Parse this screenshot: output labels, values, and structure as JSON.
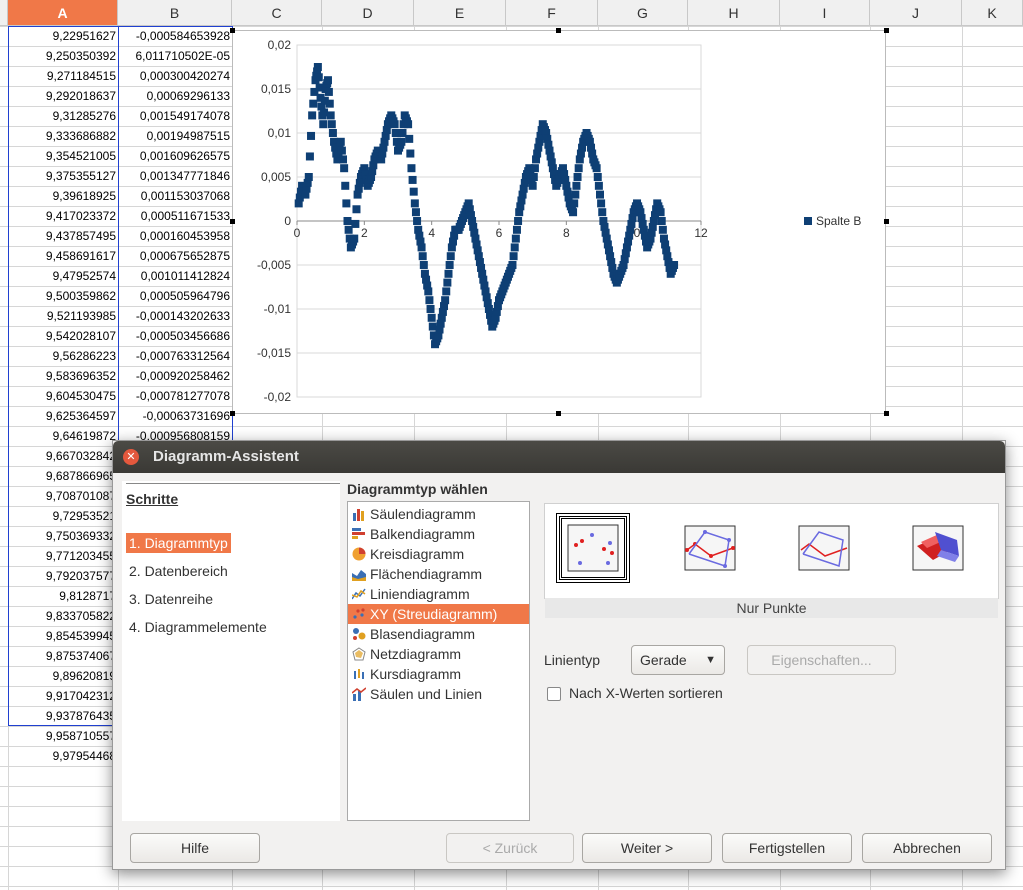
{
  "spreadsheet": {
    "columns": [
      "A",
      "B",
      "C",
      "D",
      "E",
      "F",
      "G",
      "H",
      "I",
      "J",
      "K"
    ],
    "selected_column": "A",
    "col_a": [
      "9,22951627",
      "9,250350392",
      "9,271184515",
      "9,292018637",
      "9,31285276",
      "9,333686882",
      "9,354521005",
      "9,375355127",
      "9,39618925",
      "9,417023372",
      "9,437857495",
      "9,458691617",
      "9,47952574",
      "9,500359862",
      "9,521193985",
      "9,542028107",
      "9,56286223",
      "9,583696352",
      "9,604530475",
      "9,625364597",
      "9,64619872",
      "9,667032842",
      "9,687866965",
      "9,708701087",
      "9,72953521",
      "9,750369332",
      "9,771203455",
      "9,792037577",
      "9,8128717",
      "9,833705822",
      "9,854539945",
      "9,875374067",
      "9,89620819",
      "9,917042312",
      "9,937876435",
      "9,958710557",
      "9,97954468"
    ],
    "col_b": [
      "-0,000584653928",
      "6,011710502E-05",
      "0,000300420274",
      "0,00069296133",
      "0,001549174078",
      "0,00194987515",
      "0,001609626575",
      "0,001347771846",
      "0,001153037068",
      "0,000511671533",
      "0,000160453958",
      "0,000675652875",
      "0,001011412824",
      "0,000505964796",
      "-0,000143202633",
      "-0,000503456686",
      "-0,000763312564",
      "-0,000920258462",
      "-0,000781277078",
      "-0,00063731696",
      "-0,000956808159",
      "-0,00148660806"
    ]
  },
  "chart": {
    "legend_label": "Spalte B",
    "series_color": "#0e3f74"
  },
  "chart_data": {
    "type": "scatter",
    "series": [
      {
        "name": "Spalte B",
        "points": [
          [
            0.05,
            0.002
          ],
          [
            0.15,
            0.004
          ],
          [
            0.25,
            0.003
          ],
          [
            0.35,
            0.005
          ],
          [
            0.45,
            0.012
          ],
          [
            0.55,
            0.016
          ],
          [
            0.62,
            0.0175
          ],
          [
            0.7,
            0.014
          ],
          [
            0.78,
            0.011
          ],
          [
            0.85,
            0.015
          ],
          [
            0.92,
            0.016
          ],
          [
            1.0,
            0.012
          ],
          [
            1.1,
            0.009
          ],
          [
            1.2,
            0.007
          ],
          [
            1.3,
            0.009
          ],
          [
            1.4,
            0.006
          ],
          [
            1.5,
            0.0
          ],
          [
            1.6,
            -0.003
          ],
          [
            1.7,
            -0.002
          ],
          [
            1.8,
            0.003
          ],
          [
            1.9,
            0.005
          ],
          [
            2.0,
            0.006
          ],
          [
            2.1,
            0.004
          ],
          [
            2.2,
            0.005
          ],
          [
            2.3,
            0.007
          ],
          [
            2.4,
            0.008
          ],
          [
            2.5,
            0.007
          ],
          [
            2.6,
            0.009
          ],
          [
            2.7,
            0.011
          ],
          [
            2.8,
            0.012
          ],
          [
            2.9,
            0.011
          ],
          [
            3.0,
            0.008
          ],
          [
            3.1,
            0.009
          ],
          [
            3.2,
            0.012
          ],
          [
            3.3,
            0.011
          ],
          [
            3.4,
            0.006
          ],
          [
            3.5,
            0.002
          ],
          [
            3.6,
            -0.001
          ],
          [
            3.7,
            -0.003
          ],
          [
            3.8,
            -0.006
          ],
          [
            3.9,
            -0.008
          ],
          [
            4.0,
            -0.011
          ],
          [
            4.1,
            -0.014
          ],
          [
            4.2,
            -0.013
          ],
          [
            4.3,
            -0.011
          ],
          [
            4.4,
            -0.009
          ],
          [
            4.5,
            -0.006
          ],
          [
            4.6,
            -0.003
          ],
          [
            4.7,
            -0.001
          ],
          [
            4.8,
            -0.001
          ],
          [
            4.9,
            0.0
          ],
          [
            5.0,
            0.001
          ],
          [
            5.1,
            0.002
          ],
          [
            5.2,
            0.0
          ],
          [
            5.3,
            -0.002
          ],
          [
            5.4,
            -0.004
          ],
          [
            5.5,
            -0.006
          ],
          [
            5.6,
            -0.008
          ],
          [
            5.7,
            -0.01
          ],
          [
            5.8,
            -0.012
          ],
          [
            5.9,
            -0.011
          ],
          [
            6.0,
            -0.009
          ],
          [
            6.1,
            -0.008
          ],
          [
            6.2,
            -0.007
          ],
          [
            6.3,
            -0.006
          ],
          [
            6.4,
            -0.005
          ],
          [
            6.5,
            -0.002
          ],
          [
            6.6,
            0.001
          ],
          [
            6.7,
            0.003
          ],
          [
            6.8,
            0.005
          ],
          [
            6.9,
            0.006
          ],
          [
            7.0,
            0.004
          ],
          [
            7.1,
            0.007
          ],
          [
            7.2,
            0.009
          ],
          [
            7.3,
            0.011
          ],
          [
            7.4,
            0.01
          ],
          [
            7.5,
            0.008
          ],
          [
            7.6,
            0.006
          ],
          [
            7.7,
            0.004
          ],
          [
            7.8,
            0.005
          ],
          [
            7.9,
            0.006
          ],
          [
            8.0,
            0.004
          ],
          [
            8.1,
            0.002
          ],
          [
            8.2,
            0.001
          ],
          [
            8.3,
            0.004
          ],
          [
            8.4,
            0.007
          ],
          [
            8.5,
            0.009
          ],
          [
            8.6,
            0.01
          ],
          [
            8.7,
            0.009
          ],
          [
            8.8,
            0.007
          ],
          [
            8.9,
            0.006
          ],
          [
            9.0,
            0.003
          ],
          [
            9.1,
            0.0
          ],
          [
            9.2,
            -0.002
          ],
          [
            9.3,
            -0.004
          ],
          [
            9.4,
            -0.006
          ],
          [
            9.5,
            -0.007
          ],
          [
            9.6,
            -0.006
          ],
          [
            9.7,
            -0.005
          ],
          [
            9.8,
            -0.003
          ],
          [
            9.9,
            -0.001
          ],
          [
            10.0,
            0.001
          ],
          [
            10.1,
            0.002
          ],
          [
            10.2,
            0.001
          ],
          [
            10.3,
            -0.001
          ],
          [
            10.4,
            -0.003
          ],
          [
            10.5,
            -0.002
          ],
          [
            10.6,
            0.0
          ],
          [
            10.7,
            0.002
          ],
          [
            10.8,
            0.001
          ],
          [
            10.9,
            -0.002
          ],
          [
            11.0,
            -0.004
          ],
          [
            11.1,
            -0.006
          ],
          [
            11.2,
            -0.005
          ]
        ]
      }
    ],
    "xlim": [
      0,
      12
    ],
    "ylim": [
      -0.02,
      0.02
    ],
    "x_ticks": [
      "0",
      "2",
      "4",
      "6",
      "8",
      "10",
      "12"
    ],
    "y_ticks": [
      "0,02",
      "0,015",
      "0,01",
      "0,005",
      "0",
      "-0,005",
      "-0,01",
      "-0,015",
      "-0,02"
    ],
    "legend_position": "right"
  },
  "dialog": {
    "title": "Diagramm-Assistent",
    "steps_heading": "Schritte",
    "steps": [
      "1. Diagrammtyp",
      "2. Datenbereich",
      "3. Datenreihe",
      "4. Diagrammelemente"
    ],
    "chart_type_heading": "Diagrammtyp wählen",
    "chart_types": [
      {
        "label": "Säulendiagramm",
        "icon": "column-chart-icon"
      },
      {
        "label": "Balkendiagramm",
        "icon": "bar-chart-icon"
      },
      {
        "label": "Kreisdiagramm",
        "icon": "pie-chart-icon"
      },
      {
        "label": "Flächendiagramm",
        "icon": "area-chart-icon"
      },
      {
        "label": "Liniendiagramm",
        "icon": "line-chart-icon"
      },
      {
        "label": "XY (Streudiagramm)",
        "icon": "scatter-chart-icon"
      },
      {
        "label": "Blasendiagramm",
        "icon": "bubble-chart-icon"
      },
      {
        "label": "Netzdiagramm",
        "icon": "net-chart-icon"
      },
      {
        "label": "Kursdiagramm",
        "icon": "stock-chart-icon"
      },
      {
        "label": "Säulen und Linien",
        "icon": "column-line-chart-icon"
      }
    ],
    "selected_type_index": 5,
    "subtype_caption": "Nur Punkte",
    "line_type_label": "Linientyp",
    "line_type_value": "Gerade",
    "properties_button": "Eigenschaften...",
    "sort_checkbox_label": "Nach X-Werten sortieren",
    "buttons": {
      "help": "Hilfe",
      "back": "< Zurück",
      "next": "Weiter >",
      "finish": "Fertigstellen",
      "cancel": "Abbrechen"
    },
    "colors": {
      "accent": "#f07848",
      "titlebar": "#3c3b37"
    }
  }
}
